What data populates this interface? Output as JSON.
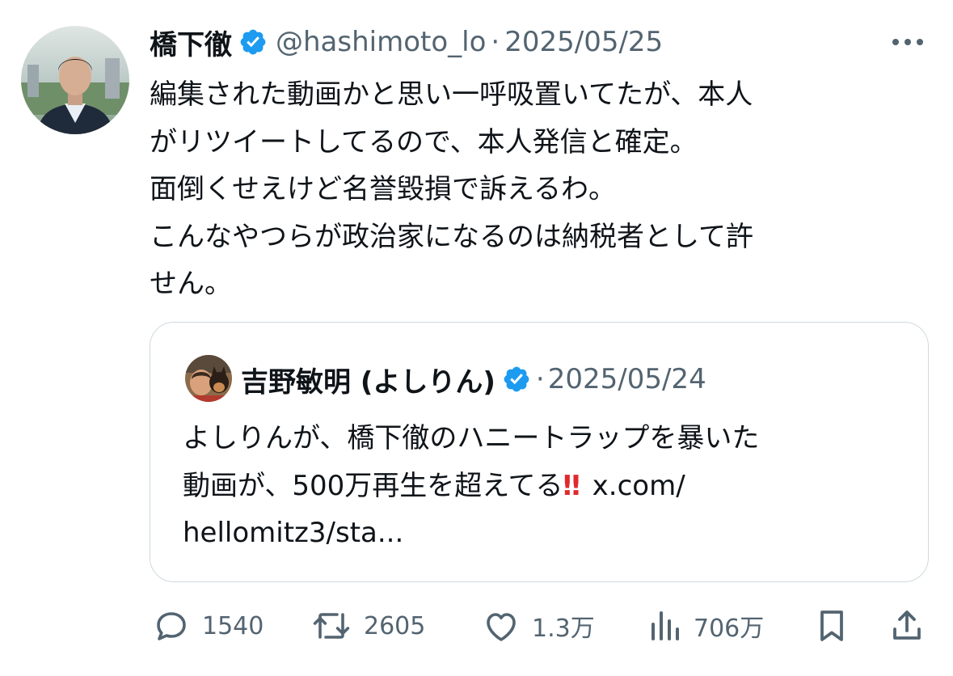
{
  "tweet": {
    "author": {
      "display_name": "橋下徹",
      "handle": "@hashimoto_lo",
      "verified": true
    },
    "separator": "·",
    "date": "2025/05/25",
    "text_lines": [
      "編集された動画かと思い一呼吸置いてたが、本人",
      "がリツイートしてるので、本人発信と確定。",
      "面倒くせえけど名誉毀損で訴えるわ。",
      "こんなやつらが政治家になるのは納税者として許",
      "せん。"
    ],
    "more_icon": "more-horizontal-icon",
    "verified_color": "#1d9bf0"
  },
  "quote": {
    "author": {
      "display_name": "吉野敏明 (よしりん)",
      "verified": true
    },
    "separator": "·",
    "date": "2025/05/24",
    "text_lines": [
      "よしりんが、橋下徹のハニートラップを暴いた",
      "動画が、500万再生を超えてる",
      "hellomitz3/sta..."
    ],
    "emphasis": "‼",
    "link_text": "x.com/"
  },
  "actions": {
    "reply": {
      "icon": "reply-icon",
      "count": "1540"
    },
    "retweet": {
      "icon": "retweet-icon",
      "count": "2605"
    },
    "like": {
      "icon": "heart-icon",
      "count": "1.3万"
    },
    "views": {
      "icon": "views-chart-icon",
      "count": "706万"
    },
    "bookmark": {
      "icon": "bookmark-icon"
    },
    "share": {
      "icon": "share-icon"
    }
  },
  "colors": {
    "text": "#0f1419",
    "secondary": "#536471",
    "border": "#cfd9de",
    "verified": "#1d9bf0",
    "emphasis": "#e0292c"
  }
}
